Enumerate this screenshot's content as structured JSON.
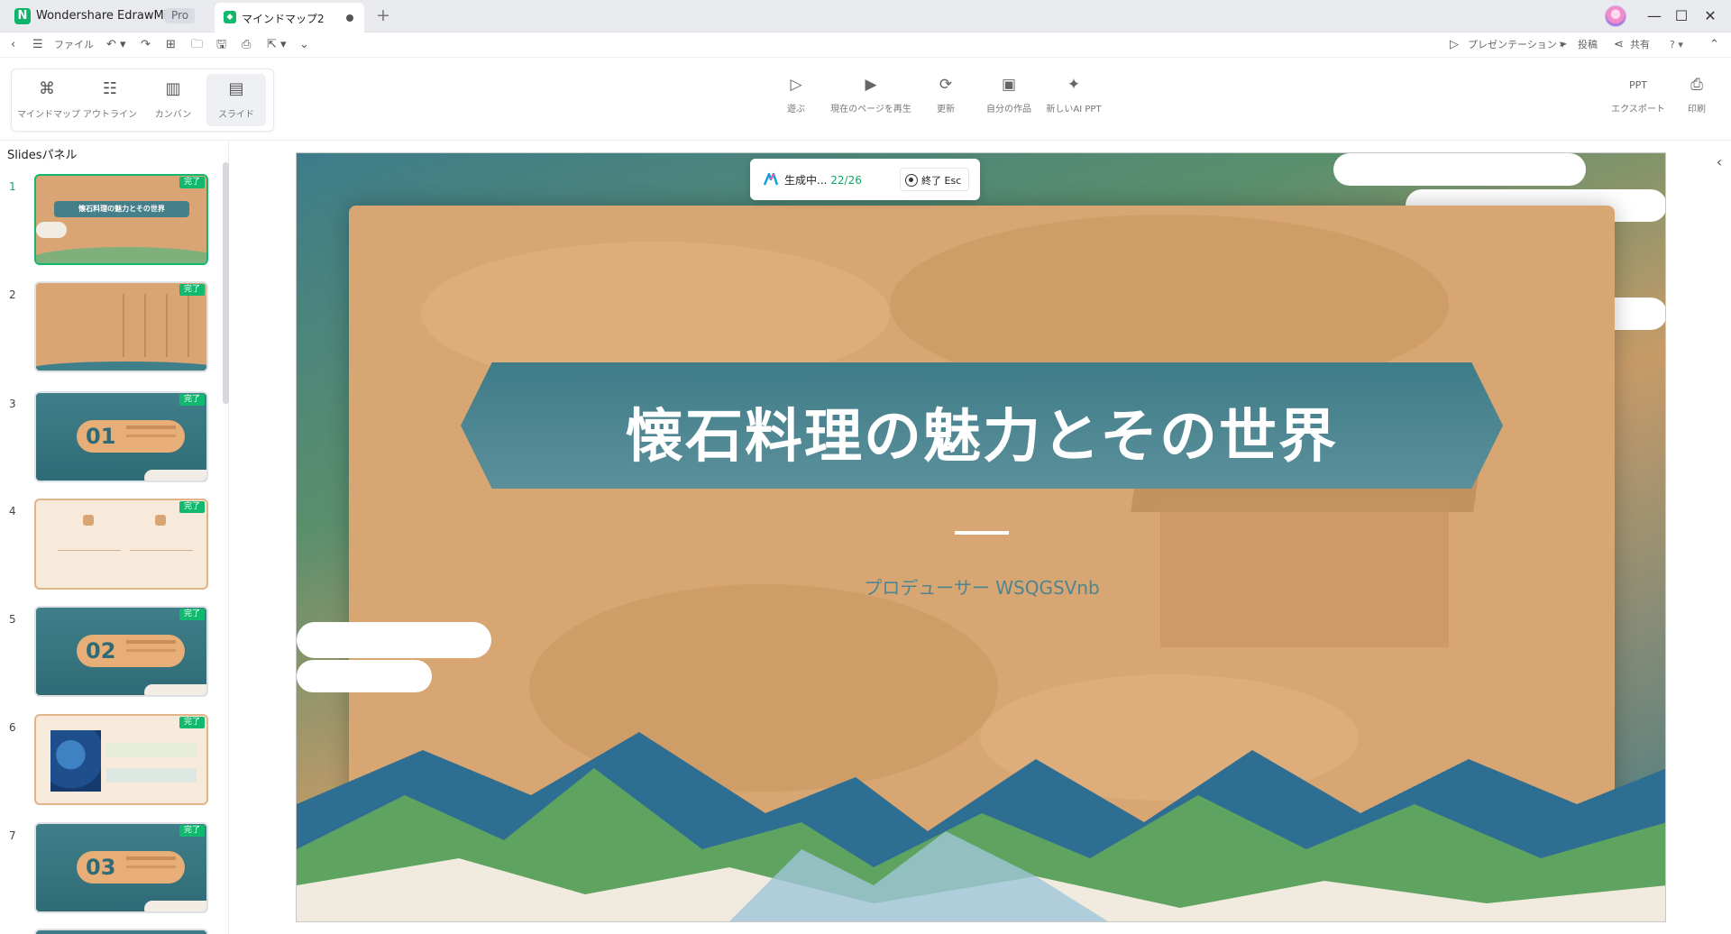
{
  "titlebar": {
    "app_name": "Wondershare EdrawMind",
    "plan_badge": "Pro",
    "tab_label": "マインドマップ2",
    "tab_add": "+",
    "minimize": "—",
    "maximize": "☐",
    "close": "✕"
  },
  "menubar": {
    "back": "‹",
    "menu": "☰",
    "file": "ファイル",
    "undo": "↶ ▾",
    "redo": "↷",
    "new": "⊞",
    "open": "🗀",
    "save": "🖫",
    "print": "⎙",
    "export": "⇱ ▾",
    "more": "⌄",
    "presentation": "プレゼンテーション ▾",
    "post": "投稿",
    "share": "共有",
    "help": "? ▾",
    "collapse": "⌃"
  },
  "views": [
    {
      "label": "マインドマップ",
      "icon": "⌘"
    },
    {
      "label": "アウトライン",
      "icon": "☷"
    },
    {
      "label": "カンバン",
      "icon": "▥"
    },
    {
      "label": "スライド",
      "icon": "▤"
    }
  ],
  "tools": [
    {
      "label": "遊ぶ",
      "icon": "▷"
    },
    {
      "label": "現在のページを再生",
      "icon": "▶"
    },
    {
      "label": "更新",
      "icon": "⟳"
    },
    {
      "label": "自分の作品",
      "icon": "▣"
    },
    {
      "label": "新しいAI PPT",
      "icon": "✦"
    }
  ],
  "right_tools": [
    {
      "label": "エクスポート",
      "icon": "PPT"
    },
    {
      "label": "印刷",
      "icon": "⎙"
    }
  ],
  "panel": {
    "title": "Slidesパネル",
    "collapse": "‹",
    "done_badge": "完了",
    "thumb1_title": "懐石料理の魅力とその世界",
    "slide_numbers": [
      "1",
      "2",
      "3",
      "4",
      "5",
      "6",
      "7"
    ],
    "section_numbers": [
      "01",
      "02",
      "03"
    ]
  },
  "slide": {
    "title": "懐石料理の魅力とその世界",
    "subtitle": "プロデューサー WSQGSVnb"
  },
  "generation": {
    "label": "生成中...",
    "count": "22/26",
    "stop_label": "終了 Esc"
  },
  "right_collapse": "‹"
}
